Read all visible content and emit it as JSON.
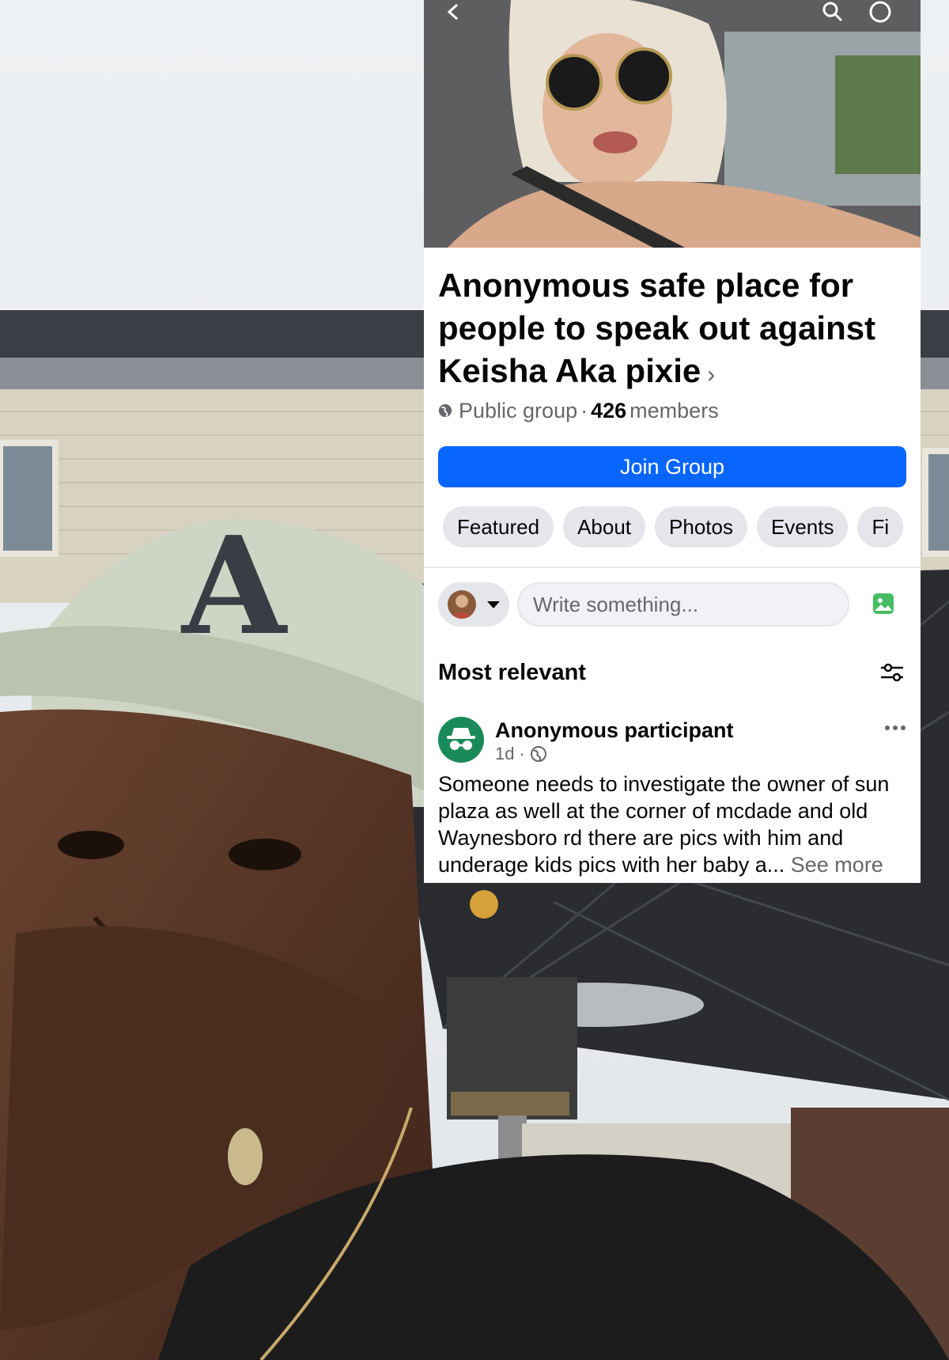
{
  "group": {
    "title": "Anonymous safe place for people to speak out against Keisha Aka pixie",
    "chevron": "›",
    "privacy": "Public group",
    "separator": "·",
    "member_count": "426",
    "member_label": "members",
    "join_label": "Join Group"
  },
  "tabs": [
    "Featured",
    "About",
    "Photos",
    "Events",
    "Fi"
  ],
  "composer": {
    "placeholder": "Write something..."
  },
  "feed": {
    "sort_label": "Most relevant"
  },
  "post": {
    "author": "Anonymous participant",
    "time": "1d",
    "separator": "·",
    "text": "Someone needs to investigate the owner of sun plaza as well at the corner of mcdade and old Waynesboro rd there are pics with him and underage kids pics with her baby a...",
    "see_more": "See more"
  },
  "icons": {
    "back": "back-arrow-icon",
    "search": "search-icon",
    "more": "more-options-icon",
    "globe": "globe-icon",
    "photo": "photo-icon",
    "filter": "filter-icon",
    "post_more": "ellipsis-icon",
    "anonymous": "anonymous-incognito-icon"
  },
  "colors": {
    "primary": "#0866ff",
    "tab_bg": "#e4e6eb",
    "secondary_text": "#65676b",
    "anonymous_avatar": "#1b8a5a",
    "photo_icon": "#45bd62"
  }
}
